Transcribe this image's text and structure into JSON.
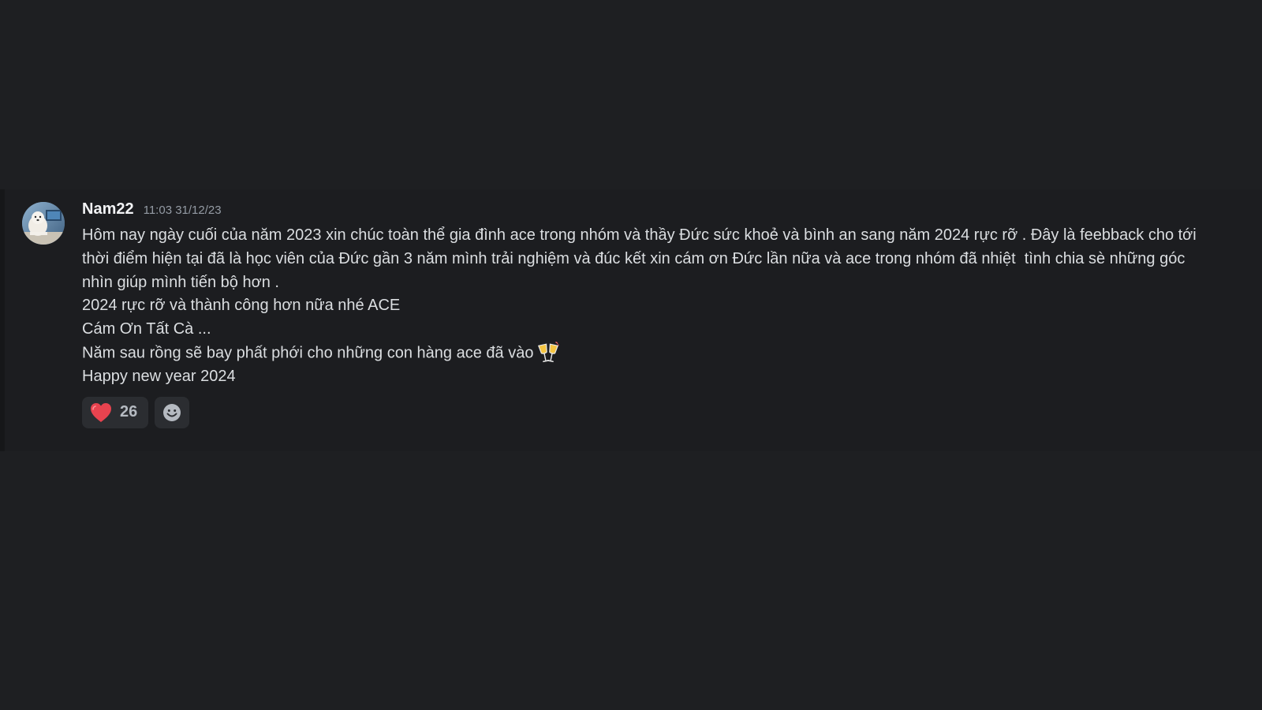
{
  "message": {
    "username": "Nam22",
    "timestamp": "11:03 31/12/23",
    "lines": [
      "Hôm nay ngày cuối của năm 2023 xin chúc toàn thể gia đình ace trong nhóm và thầy Đức sức khoẻ và bình an sang năm 2024 rực rỡ . Đây là feebback cho tới",
      "thời điểm hiện tại đã là học viên của Đức gần 3 năm mình trải nghiệm và đúc kết xin cám ơn Đức lần nữa và ace trong nhóm đã nhiệt  tình chia sè những góc",
      "nhìn giúp mình tiến bộ hơn .",
      "2024 rực rỡ và thành công hơn nữa nhé ACE",
      "Cám Ơn Tất Cà ...",
      "Năm sau rồng sẽ bay phất phới cho những con hàng ace đã vào",
      "Happy new year 2024"
    ],
    "inline_emoji": "clinking-glasses-icon",
    "reactions": [
      {
        "icon": "heart-icon",
        "count": "26",
        "color": "#e8434f"
      }
    ],
    "add_reaction_icon": "smiley-icon"
  },
  "colors": {
    "background": "#1e1f22",
    "message_background": "#1c1d20",
    "username": "#f2f3f5",
    "timestamp": "#949ba4",
    "text": "#dbdee1",
    "reaction_background": "#2b2d31"
  }
}
